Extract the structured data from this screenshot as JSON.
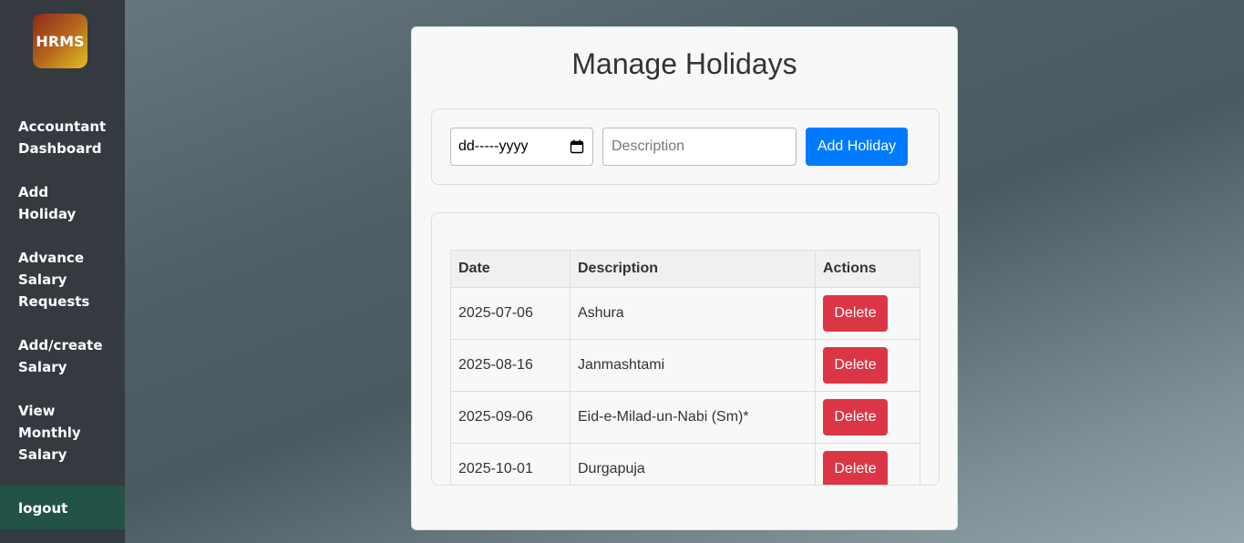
{
  "sidebar": {
    "logo_text": "HRMS",
    "items": [
      {
        "label": "Accountant Dashboard"
      },
      {
        "label": "Add Holiday"
      },
      {
        "label": "Advance Salary Requests"
      },
      {
        "label": "Add/create Salary"
      },
      {
        "label": "View Monthly Salary"
      }
    ],
    "logout_label": "logout"
  },
  "main": {
    "title": "Manage Holidays",
    "form": {
      "date_placeholder": "dd-----yyyy",
      "description_placeholder": "Description",
      "add_button_label": "Add Holiday"
    },
    "table": {
      "headers": [
        "Date",
        "Description",
        "Actions"
      ],
      "rows": [
        {
          "date": "2025-07-06",
          "description": "Ashura",
          "action": "Delete"
        },
        {
          "date": "2025-08-16",
          "description": "Janmashtami",
          "action": "Delete"
        },
        {
          "date": "2025-09-06",
          "description": "Eid-e-Milad-un-Nabi (Sm)*",
          "action": "Delete"
        },
        {
          "date": "2025-10-01",
          "description": "Durgapuja",
          "action": "Delete"
        }
      ]
    }
  },
  "colors": {
    "sidebar_bg": "#343a40",
    "logout_bg": "#235347",
    "primary": "#007bff",
    "danger": "#dc3545"
  }
}
